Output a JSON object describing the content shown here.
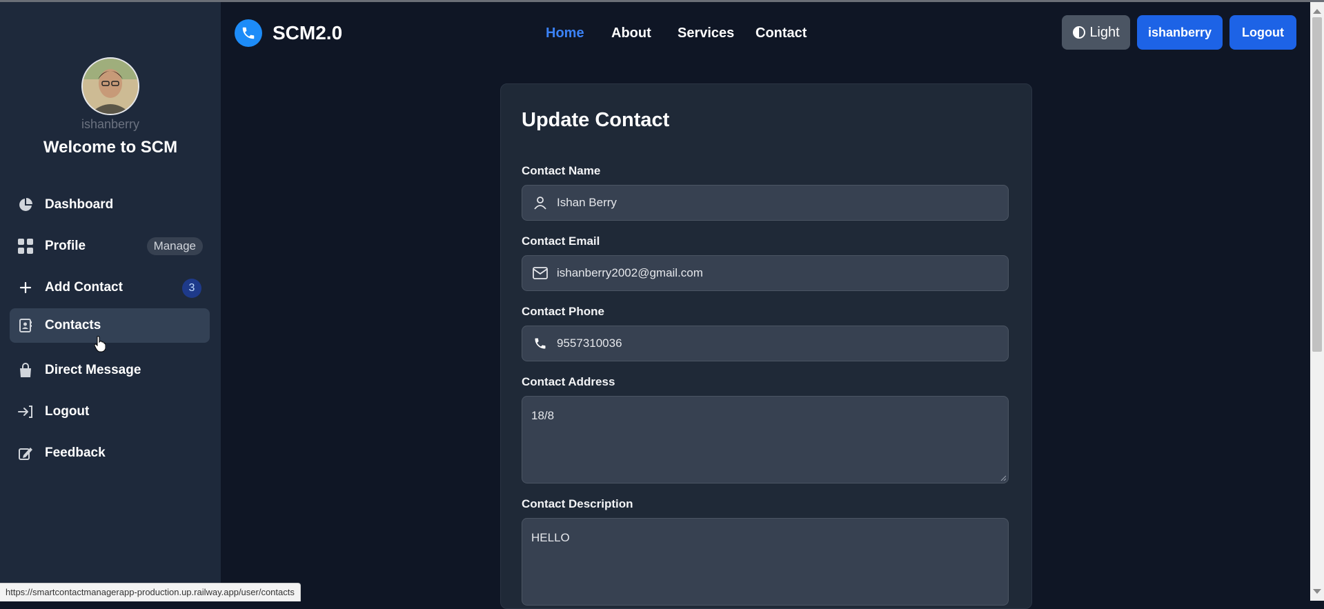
{
  "header": {
    "brand": "SCM2.0",
    "nav": [
      "Home",
      "About",
      "Services",
      "Contact"
    ],
    "theme_button": "Light",
    "user_button": "ishanberry",
    "logout_button": "Logout"
  },
  "sidebar": {
    "username": "ishanberry",
    "welcome": "Welcome to SCM",
    "items": [
      {
        "label": "Dashboard",
        "icon": "pie-chart-icon"
      },
      {
        "label": "Profile",
        "icon": "grid-icon",
        "badge": "Manage"
      },
      {
        "label": "Add Contact",
        "icon": "plus-icon",
        "badge": "3"
      },
      {
        "label": "Contacts",
        "icon": "contact-book-icon",
        "active": true
      },
      {
        "label": "Direct Message",
        "icon": "bag-icon"
      },
      {
        "label": "Logout",
        "icon": "logout-icon"
      },
      {
        "label": "Feedback",
        "icon": "feedback-icon"
      }
    ]
  },
  "form": {
    "title": "Update Contact",
    "name_label": "Contact Name",
    "name_value": "Ishan Berry",
    "email_label": "Contact Email",
    "email_value": "ishanberry2002@gmail.com",
    "phone_label": "Contact Phone",
    "phone_value": "9557310036",
    "address_label": "Contact Address",
    "address_value": "18/8",
    "description_label": "Contact Description",
    "description_value": "HELLO"
  },
  "statusbar": {
    "url": "https://smartcontactmanagerapp-production.up.railway.app/user/contacts"
  },
  "colors": {
    "accent": "#1d63e6",
    "nav_active": "#3b82f6",
    "sidebar_bg": "#1e293b",
    "page_bg": "#0f1625"
  }
}
